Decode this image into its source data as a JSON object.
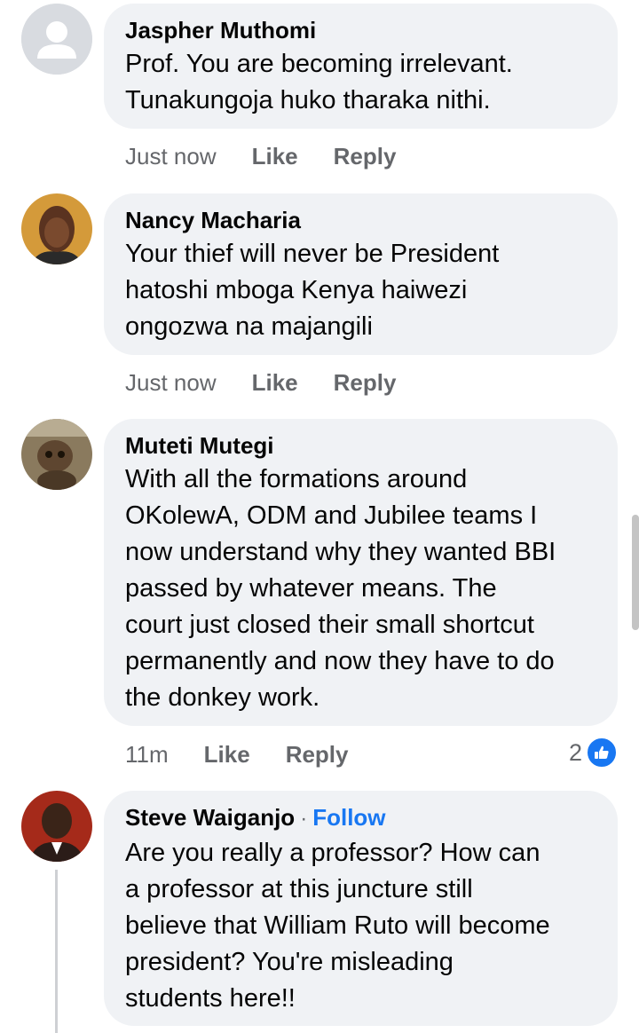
{
  "comments": [
    {
      "name": "Jaspher Muthomi",
      "lines": [
        "Prof. You  are becoming irrelevant.",
        "Tunakungoja huko tharaka nithi."
      ],
      "time": "Just now",
      "like": "Like",
      "reply": "Reply"
    },
    {
      "name": "Nancy Macharia",
      "lines": [
        "Your thief will never be President",
        "hatoshi mboga Kenya haiwezi",
        "ongozwa na majangili"
      ],
      "time": "Just now",
      "like": "Like",
      "reply": "Reply"
    },
    {
      "name": "Muteti Mutegi",
      "lines": [
        "With all the formations around",
        "OKolewA, ODM and Jubilee teams I",
        "now understand why they wanted BBI",
        "passed by whatever means. The",
        "court just closed their small shortcut",
        "permanently and now they have to do",
        "the donkey work."
      ],
      "time": "11m",
      "like": "Like",
      "reply": "Reply",
      "reaction_count": "2"
    },
    {
      "name": "Steve Waiganjo",
      "separator": "·",
      "follow": "Follow",
      "lines": [
        "Are you really a professor? How can",
        "a professor at this juncture still",
        "believe that William Ruto will become",
        "president? You're misleading",
        "students here!!"
      ]
    }
  ],
  "colors": {
    "bubble": "#f0f2f5",
    "meta": "#65676b",
    "accent": "#1877f2"
  }
}
